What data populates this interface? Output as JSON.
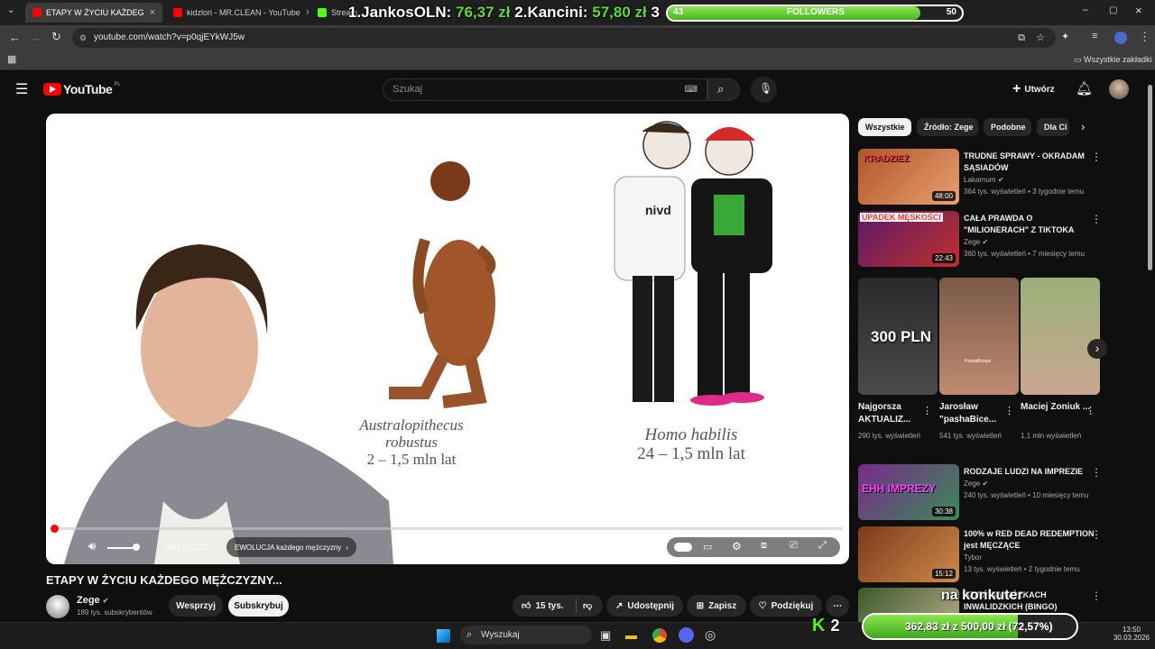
{
  "browser": {
    "tabs": [
      {
        "label": "ETAPY W ŻYCIU KAŻDEGO MĘŻ",
        "active": true
      },
      {
        "label": "kidzlori - MR.CLEAN - YouTube",
        "active": false
      },
      {
        "label": "Stream",
        "active": false
      }
    ],
    "url": "youtube.com/watch?v=p0qjEYkWJ5w",
    "bookmarks_label": "Wszystkie zakładki"
  },
  "overlay": {
    "ranking_prefix1": "1.JankosOLN: ",
    "ranking_amount1": "76,37 zł",
    "ranking_prefix2": " 2.Kancini: ",
    "ranking_amount2": "57,80 zł",
    "ranking_suffix": " 3",
    "followers": {
      "current": "43",
      "label": "FOLLOWERS",
      "goal": "50",
      "fraction": 0.86
    },
    "stream_text": "na konkuter",
    "k_count": "2",
    "donation": {
      "text": "362,83 zł z 500,00 zł (72,57%)",
      "fraction": 0.7257
    }
  },
  "youtube": {
    "logo": "YouTube",
    "logo_region": "PL",
    "search_placeholder": "Szukaj",
    "create_label": "Utwórz"
  },
  "player": {
    "time": "0:01 / 22:01",
    "chapter": "EWOLUCJA każdego mężczyzny",
    "progress_fraction": 0.001,
    "slide": {
      "left_name1": "Australopithecus",
      "left_name2": "robustus",
      "left_range": "2 – 1,5 mln lat",
      "right_name": "Homo habilis",
      "right_range": "24 – 1,5 mln lat"
    }
  },
  "video": {
    "title": "ETAPY W ŻYCIU KAŻDEGO MĘŻCZYZNY...",
    "channel": "Zege",
    "subscribers": "189 tys. subskrybentów",
    "support_label": "Wesprzyj",
    "subscribe_label": "Subskrybuj",
    "likes": "15 tys.",
    "share_label": "Udostępnij",
    "save_label": "Zapisz",
    "thanks_label": "Podziękuj"
  },
  "sidebar": {
    "chips": [
      "Wszystkie",
      "Źródło: Zege",
      "Podobne",
      "Dla Ci"
    ],
    "recs": [
      {
        "title": "TRUDNE SPRAWY - OKRADAM SĄSIADÓW",
        "channel": "Lakarnum",
        "meta": "364 tys. wyświetleń • 3 tygodnie temu",
        "duration": "48:00",
        "thumb_text": "KRADZIEŻ",
        "color": "#b0552a"
      },
      {
        "title": "CAŁA PRAWDA O \"MILIONERACH\" Z TIKTOKA",
        "channel": "Zege",
        "meta": "360 tys. wyświetleń • 7 miesięcy temu",
        "duration": "22:43",
        "thumb_text": "UPADEK MĘSKOŚCI",
        "color": "#5a1a6a"
      },
      {
        "title": "RODZAJE LUDZI NA IMPREZIE",
        "channel": "Zege",
        "meta": "240 tys. wyświetleń • 10 miesięcy temu",
        "duration": "30:38",
        "thumb_text": "EHH IMPREZY",
        "color": "#7a2a8a"
      },
      {
        "title": "100% w RED DEAD REDEMPTION jest MĘCZĄCE",
        "channel": "Tybor",
        "meta": "13 tys. wyświetleń • 2 tygodnie temu",
        "duration": "15:12",
        "thumb_text": "",
        "color": "#7a3a1a"
      },
      {
        "title": "DZIEŃ NA WÓZKACH INWALIDZKICH (BINGO)",
        "channel": "",
        "meta": "",
        "duration": "",
        "thumb_text": "",
        "color": "#3a5a2a"
      }
    ],
    "shorts": [
      {
        "title": "Najgorsza AKTUALIZ...",
        "meta": "290 tys. wyświetleń",
        "thumb_text": "300 PLN",
        "color": "#3a3a3a"
      },
      {
        "title": "Jarosław \"pashaBice...",
        "meta": "541 tys. wyświetleń",
        "thumb_text": "PashaBiceps",
        "color": "#8a5a4a"
      },
      {
        "title": "Maciej Zoniuk ...",
        "meta": "1,1 mln wyświetleń",
        "thumb_text": "",
        "color": "#6a8a5a"
      }
    ]
  },
  "taskbar": {
    "search": "Wyszukaj",
    "time": "13:50",
    "date": "30.03.2026"
  },
  "colors": {
    "accent_green": "#5fd93a",
    "yt_red": "#ff0000",
    "bg": "#0f0f0f"
  }
}
